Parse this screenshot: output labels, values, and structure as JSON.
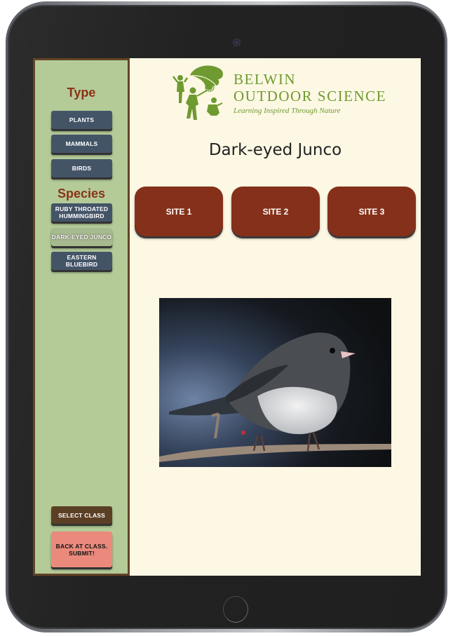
{
  "sidebar": {
    "type_heading": "Type",
    "type_buttons": [
      "PLANTS",
      "MAMMALS",
      "BIRDS"
    ],
    "species_heading": "Species",
    "species_buttons": [
      {
        "label": "RUBY THROATED HUMMINGBIRD",
        "active": false
      },
      {
        "label": "DARK-EYED JUNCO",
        "active": true
      },
      {
        "label": "EASTERN BLUEBIRD",
        "active": false
      }
    ],
    "select_class_label": "SELECT CLASS",
    "submit_label": "BACK AT CLASS. SUBMIT!"
  },
  "logo": {
    "line1": "BELWIN",
    "line2": "OUTDOOR SCIENCE",
    "tagline": "Learning Inspired Through Nature"
  },
  "main": {
    "title": "Dark-eyed Junco",
    "sites": [
      "SITE 1",
      "SITE 2",
      "SITE 3"
    ],
    "photo_alt": "Dark-eyed Junco perched on a branch"
  },
  "colors": {
    "sidebar_bg": "#b4cb98",
    "sidebar_border": "#634425",
    "heading": "#8a3318",
    "nav_button": "#445467",
    "site_button": "#85301a",
    "submit_button": "#ea8a7d",
    "select_class_button": "#5b3f25",
    "logo_green": "#6f9a30",
    "screen_bg": "#fdf8e4"
  }
}
